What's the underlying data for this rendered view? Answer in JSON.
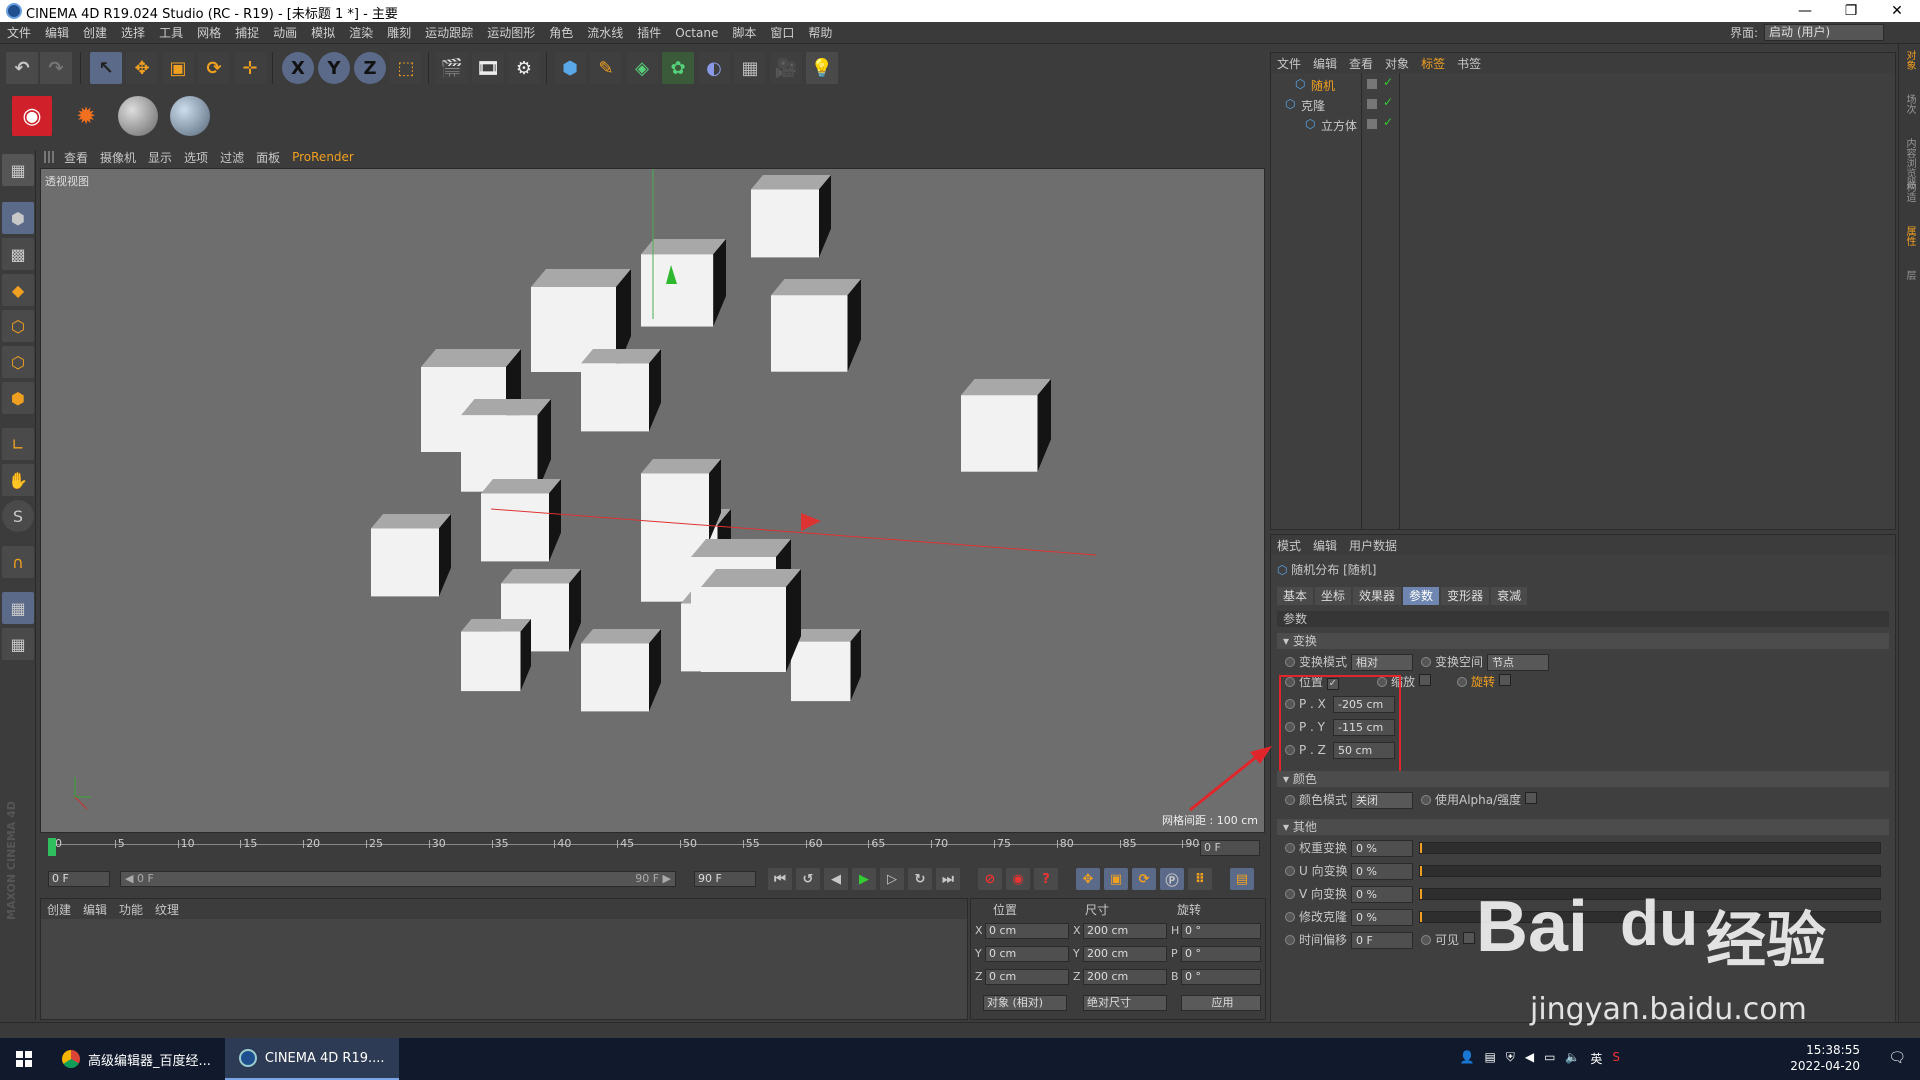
{
  "title_bar": {
    "text": "CINEMA 4D R19.024 Studio (RC - R19) - [未标题 1 *] - 主要",
    "minimize": "—",
    "restore": "❐",
    "close": "✕"
  },
  "menu": [
    "文件",
    "编辑",
    "创建",
    "选择",
    "工具",
    "网格",
    "捕捉",
    "动画",
    "模拟",
    "渲染",
    "雕刻",
    "运动跟踪",
    "运动图形",
    "角色",
    "流水线",
    "插件",
    "Octane",
    "脚本",
    "窗口",
    "帮助"
  ],
  "layout": {
    "label": "界面:",
    "value": "启动 (用户)"
  },
  "toolbar": {
    "axis_x": "X",
    "axis_y": "Y",
    "axis_z": "Z"
  },
  "left_tools": {
    "snap": "S"
  },
  "viewport_menu": [
    "查看",
    "摄像机",
    "显示",
    "选项",
    "过滤",
    "面板",
    "ProRender"
  ],
  "viewport": {
    "name": "透视视图",
    "grid_spacing": "网格间距 : 100 cm"
  },
  "timeline": {
    "ticks": [
      "0",
      "5",
      "10",
      "15",
      "20",
      "25",
      "30",
      "35",
      "40",
      "45",
      "50",
      "55",
      "60",
      "65",
      "70",
      "75",
      "80",
      "85",
      "90"
    ],
    "current_frame": "0 F"
  },
  "playback": {
    "start": "0 F",
    "range_start": "◀ 0 F",
    "range_end": "90 F ▶",
    "end": "90 F"
  },
  "material_manager": {
    "menu": [
      "创建",
      "编辑",
      "功能",
      "纹理"
    ]
  },
  "maxon_logo": "MAXON CINEMA 4D",
  "coords": {
    "headers": {
      "pos": "位置",
      "size": "尺寸",
      "rot": "旋转"
    },
    "rows": [
      {
        "axis": "X",
        "pos": "0 cm",
        "saxis": "X",
        "size": "200 cm",
        "raxis": "H",
        "rot": "0 °"
      },
      {
        "axis": "Y",
        "pos": "0 cm",
        "saxis": "Y",
        "size": "200 cm",
        "raxis": "P",
        "rot": "0 °"
      },
      {
        "axis": "Z",
        "pos": "0 cm",
        "saxis": "Z",
        "size": "200 cm",
        "raxis": "B",
        "rot": "0 °"
      }
    ],
    "mode": "对象 (相对)",
    "size_mode": "绝对尺寸",
    "apply": "应用"
  },
  "object_manager": {
    "menu": [
      "文件",
      "编辑",
      "查看",
      "对象",
      "标签",
      "书签"
    ],
    "objects": [
      {
        "name": "随机",
        "indent": 1,
        "color": "#f0a020"
      },
      {
        "name": "克隆",
        "indent": 0,
        "color": "#c8c8c8"
      },
      {
        "name": "立方体",
        "indent": 2,
        "color": "#c8c8c8"
      }
    ]
  },
  "attributes": {
    "menu": [
      "模式",
      "编辑",
      "用户数据"
    ],
    "object_title": "随机分布 [随机]",
    "tabs": [
      "基本",
      "坐标",
      "效果器",
      "参数",
      "变形器",
      "衰减"
    ],
    "active_tab": "参数",
    "section_params": "参数",
    "sec_transform": "▾ 变换",
    "transform_mode_label": "变换模式",
    "transform_mode_value": "相对",
    "transform_space_label": "变换空间",
    "transform_space_value": "节点",
    "position_label": "位置",
    "position_check": "✓",
    "scale_label": "缩放",
    "rotation_label": "旋转",
    "px_label": "P . X",
    "px_value": "-205 cm",
    "py_label": "P . Y",
    "py_value": "-115 cm",
    "pz_label": "P . Z",
    "pz_value": "50 cm",
    "sec_color": "▾ 颜色",
    "color_mode_label": "颜色模式",
    "color_mode_value": "关闭",
    "alpha_label": "使用Alpha/强度",
    "sec_other": "▾ 其他",
    "others": [
      {
        "label": "权重变换",
        "value": "0 %"
      },
      {
        "label": "U 向变换",
        "value": "0 %"
      },
      {
        "label": "V 向变换",
        "value": "0 %"
      },
      {
        "label": "修改克隆",
        "value": "0 %"
      }
    ],
    "time_offset_label": "时间偏移",
    "time_offset_value": "0 F",
    "visible_label": "可见"
  },
  "right_strip": [
    "对象",
    "场次",
    "内容浏览器",
    "构造",
    "属性",
    "层"
  ],
  "taskbar": {
    "apps": [
      {
        "label": "高级编辑器_百度经..."
      },
      {
        "label": "CINEMA 4D R19...."
      }
    ],
    "time": "15:38:55",
    "date": "2022-04-20",
    "lang": "英"
  },
  "watermark": {
    "brand": "Bai",
    "paw": "du",
    "cn": "经验",
    "url": "jingyan.baidu.com"
  },
  "colors": {
    "accent": "#f0a020",
    "highlight": "#e0262b",
    "active_tab": "#6f87b0"
  }
}
